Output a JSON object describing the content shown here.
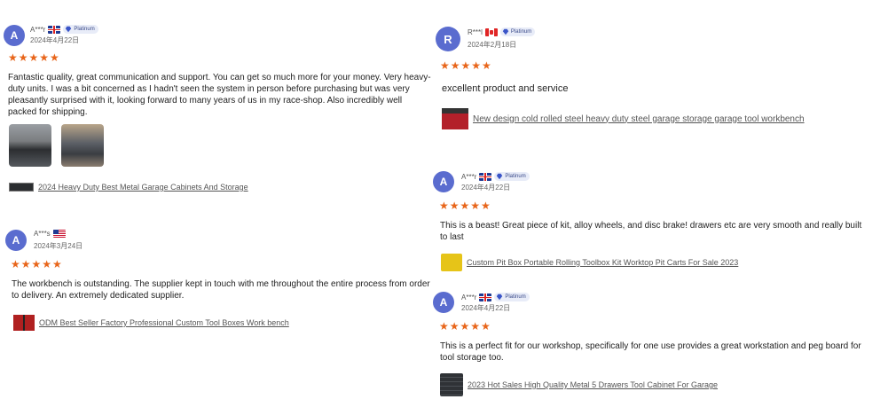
{
  "reviews": [
    {
      "initial": "A",
      "name": "A***r",
      "flag": "uk-flag",
      "badge": "Platinum",
      "date": "2024年4月22日",
      "stars": "★★★★★",
      "text": "Fantastic quality, great communication and support. You can get so much more for your money. Very heavy-duty units. I was a bit concerned as I hadn't seen the system in person before purchasing but was very pleasantly surprised with it, looking forward to many years of us in my race-shop. Also incredibly well packed for shipping.",
      "product": "2024 Heavy Duty Best Metal Garage Cabinets And Storage"
    },
    {
      "initial": "A",
      "name": "A***s",
      "flag": "us-flag",
      "badge": "",
      "date": "2024年3月24日",
      "stars": "★★★★★",
      "text": "The workbench is outstanding. The supplier kept in touch with me throughout the entire process from order to delivery. An extremely dedicated supplier.",
      "product": "ODM Best Seller Factory Professional Custom Tool Boxes Work bench"
    },
    {
      "initial": "R",
      "name": "R***l",
      "flag": "canada-flag",
      "badge": "Platinum",
      "date": "2024年2月18日",
      "stars": "★★★★★",
      "text": "excellent product and service",
      "product": "New design cold rolled steel heavy duty steel garage storage garage tool workbench"
    },
    {
      "initial": "A",
      "name": "A***r",
      "flag": "uk-flag",
      "badge": "Platinum",
      "date": "2024年4月22日",
      "stars": "★★★★★",
      "text": "This is a beast! Great piece of kit, alloy wheels, and disc brake! drawers etc are very smooth and really built to last",
      "product": "Custom Pit Box Portable Rolling Toolbox Kit Worktop Pit Carts For Sale 2023"
    },
    {
      "initial": "A",
      "name": "A***r",
      "flag": "uk-flag",
      "badge": "Platinum",
      "date": "2024年4月22日",
      "stars": "★★★★★",
      "text": "This is a perfect fit for our workshop, specifically for one use provides a great workstation and peg board for tool storage too.",
      "product": "2023 Hot Sales High Quality Metal 5 Drawers Tool Cabinet For Garage"
    }
  ],
  "colors": {
    "avatar": "#5a6ccf",
    "stars": "#e8651a",
    "badge_bg": "#e8ecf8"
  }
}
